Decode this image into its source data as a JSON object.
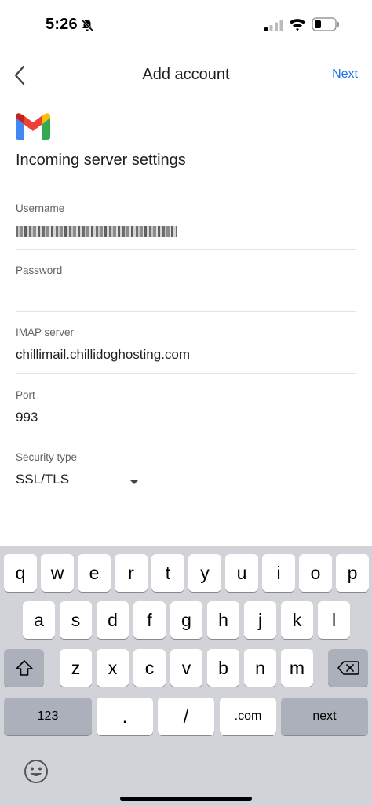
{
  "status_bar": {
    "time": "5:26"
  },
  "header": {
    "title": "Add account",
    "next_label": "Next"
  },
  "section_title": "Incoming server settings",
  "fields": {
    "username": {
      "label": "Username"
    },
    "password": {
      "label": "Password",
      "value": ""
    },
    "imap": {
      "label": "IMAP server",
      "value": "chillimail.chillidoghosting.com"
    },
    "port": {
      "label": "Port",
      "value": "993"
    },
    "security": {
      "label": "Security type",
      "value": "SSL/TLS"
    }
  },
  "keyboard": {
    "row1": [
      "q",
      "w",
      "e",
      "r",
      "t",
      "y",
      "u",
      "i",
      "o",
      "p"
    ],
    "row2": [
      "a",
      "s",
      "d",
      "f",
      "g",
      "h",
      "j",
      "k",
      "l"
    ],
    "row3": [
      "z",
      "x",
      "c",
      "v",
      "b",
      "n",
      "m"
    ],
    "numbers": "123",
    "dot": ".",
    "slash": "/",
    "dotcom": ".com",
    "next": "next"
  },
  "icons": [
    "bell-off-icon",
    "cellular-signal-icon",
    "wifi-icon",
    "battery-icon",
    "back-arrow-icon",
    "gmail-logo-icon",
    "dropdown-arrow-icon",
    "shift-icon",
    "backspace-icon",
    "emoji-icon"
  ]
}
